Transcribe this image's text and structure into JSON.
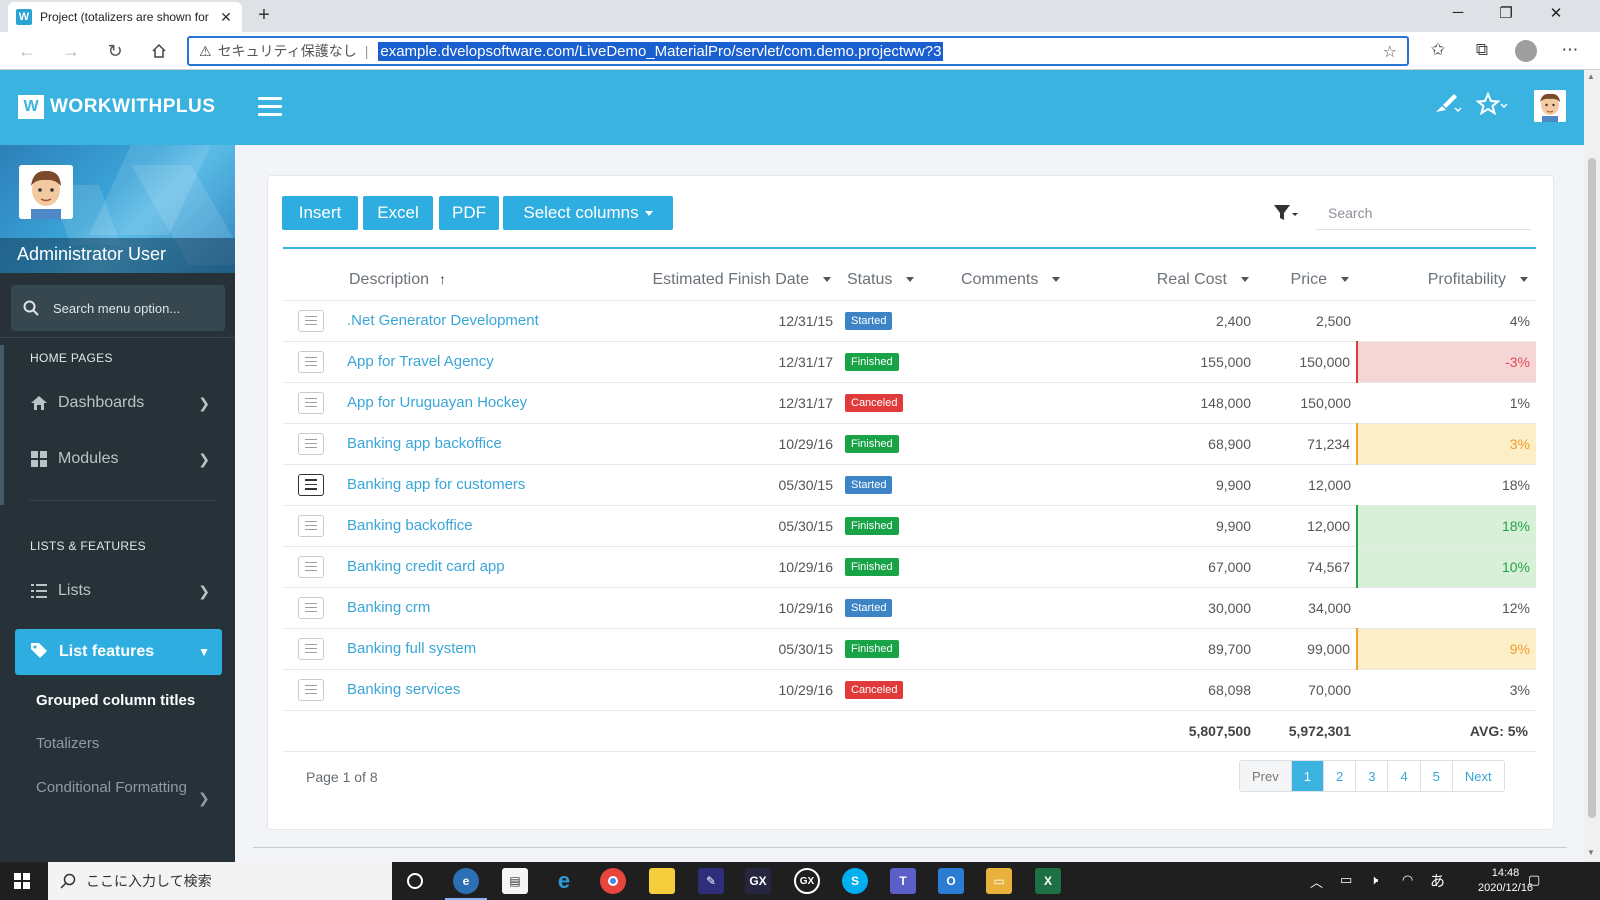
{
  "browser": {
    "tab_title": "Project (totalizers are shown for",
    "tab_favicon": "W",
    "new_tab": "+",
    "address_security": "セキュリティ保護なし",
    "address_url": "example.dvelopsoftware.com/LiveDemo_MaterialPro/servlet/com.demo.projectww?3"
  },
  "app": {
    "brand": "WORKWITHPLUS",
    "brand_mark": "W"
  },
  "sidebar": {
    "user_name": "Administrator User",
    "search_placeholder": "Search menu option...",
    "sections": [
      "HOME PAGES",
      "LISTS & FEATURES"
    ],
    "items": [
      {
        "label": "Dashboards",
        "icon": "home-icon"
      },
      {
        "label": "Modules",
        "icon": "grid-icon"
      },
      {
        "label": "Lists",
        "icon": "list-icon"
      }
    ],
    "active_item": {
      "label": "List features",
      "icon": "tag-icon"
    },
    "sub_items": [
      "Grouped column titles",
      "Totalizers",
      "Conditional Formatting"
    ]
  },
  "toolbar": {
    "insert": "Insert",
    "excel": "Excel",
    "pdf": "PDF",
    "select_columns": "Select columns",
    "search_placeholder": "Search"
  },
  "grid": {
    "columns": [
      "Description",
      "Estimated Finish Date",
      "Status",
      "Comments",
      "Real Cost",
      "Price",
      "Profitability"
    ],
    "rows": [
      {
        "description": ".Net Generator Development",
        "date": "12/31/15",
        "status": "Started",
        "comments": "",
        "real_cost": "2,400",
        "price": "2,500",
        "profitability": "4%",
        "highlight": "none"
      },
      {
        "description": "App for Travel Agency",
        "date": "12/31/17",
        "status": "Finished",
        "comments": "",
        "real_cost": "155,000",
        "price": "150,000",
        "profitability": "-3%",
        "highlight": "neg"
      },
      {
        "description": "App for Uruguayan Hockey",
        "date": "12/31/17",
        "status": "Canceled",
        "comments": "",
        "real_cost": "148,000",
        "price": "150,000",
        "profitability": "1%",
        "highlight": "none"
      },
      {
        "description": "Banking app backoffice",
        "date": "10/29/16",
        "status": "Finished",
        "comments": "",
        "real_cost": "68,900",
        "price": "71,234",
        "profitability": "3%",
        "highlight": "warn"
      },
      {
        "description": "Banking app for customers",
        "date": "05/30/15",
        "status": "Started",
        "comments": "",
        "real_cost": "9,900",
        "price": "12,000",
        "profitability": "18%",
        "highlight": "none"
      },
      {
        "description": "Banking backoffice",
        "date": "05/30/15",
        "status": "Finished",
        "comments": "",
        "real_cost": "9,900",
        "price": "12,000",
        "profitability": "18%",
        "highlight": "good"
      },
      {
        "description": "Banking credit card app",
        "date": "10/29/16",
        "status": "Finished",
        "comments": "",
        "real_cost": "67,000",
        "price": "74,567",
        "profitability": "10%",
        "highlight": "good"
      },
      {
        "description": "Banking crm",
        "date": "10/29/16",
        "status": "Started",
        "comments": "",
        "real_cost": "30,000",
        "price": "34,000",
        "profitability": "12%",
        "highlight": "none"
      },
      {
        "description": "Banking full system",
        "date": "05/30/15",
        "status": "Finished",
        "comments": "",
        "real_cost": "89,700",
        "price": "99,000",
        "profitability": "9%",
        "highlight": "warn"
      },
      {
        "description": "Banking services",
        "date": "10/29/16",
        "status": "Canceled",
        "comments": "",
        "real_cost": "68,098",
        "price": "70,000",
        "profitability": "3%",
        "highlight": "none"
      }
    ],
    "totals": {
      "real_cost": "5,807,500",
      "price": "5,972,301",
      "profitability": "AVG: 5%"
    }
  },
  "pagination": {
    "info": "Page 1 of 8",
    "prev": "Prev",
    "pages": [
      "1",
      "2",
      "3",
      "4",
      "5"
    ],
    "next": "Next",
    "current": "1"
  },
  "taskbar": {
    "search_placeholder": "ここに入力して検索",
    "ime": "あ",
    "time": "14:48",
    "date": "2020/12/16"
  },
  "colors": {
    "accent": "#3bb3e0",
    "sidebar_bg": "#263238",
    "started": "#3d84c6",
    "finished": "#19a347",
    "canceled": "#e03a3a"
  }
}
